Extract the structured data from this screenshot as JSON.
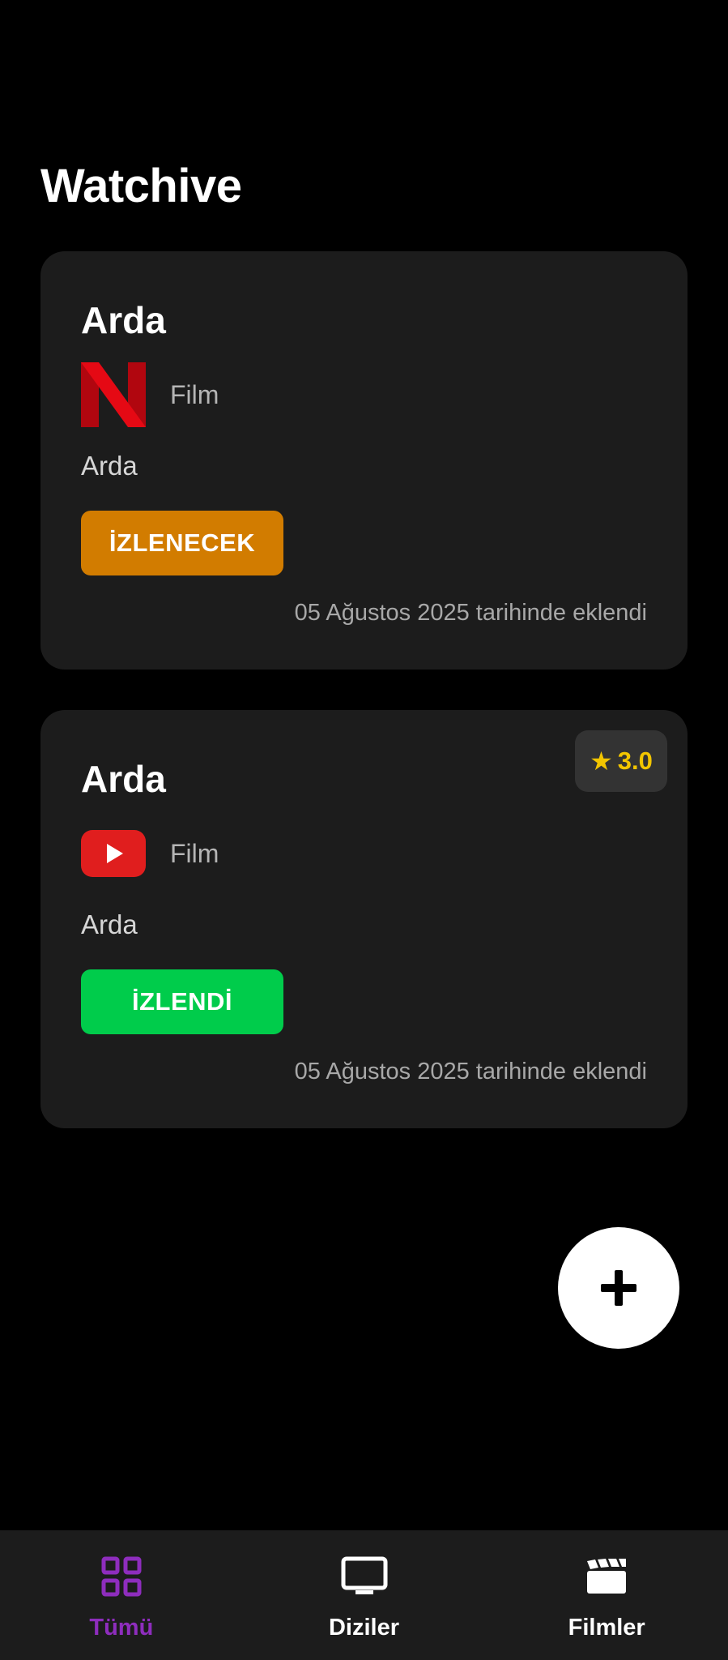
{
  "app": {
    "title": "Watchive"
  },
  "cards": [
    {
      "title": "Arda",
      "platform_icon": "netflix-logo",
      "type": "Film",
      "subtitle": "Arda",
      "status": "İZLENECEK",
      "status_color": "#d27c00",
      "added_text": "05 Ağustos 2025 tarihinde eklendi"
    },
    {
      "title": "Arda",
      "platform_icon": "youtube-logo",
      "type": "Film",
      "subtitle": "Arda",
      "status": "İZLENDİ",
      "status_color": "#00cc4b",
      "added_text": "05 Ağustos 2025 tarihinde eklendi",
      "rating": "3.0"
    }
  ],
  "fab": {
    "icon": "plus-icon"
  },
  "bottom_nav": {
    "items": [
      {
        "label": "Tümü",
        "icon": "grid-icon",
        "active": true
      },
      {
        "label": "Diziler",
        "icon": "tv-icon",
        "active": false
      },
      {
        "label": "Filmler",
        "icon": "clapperboard-icon",
        "active": false
      }
    ],
    "active_color": "#8e2dbd"
  }
}
